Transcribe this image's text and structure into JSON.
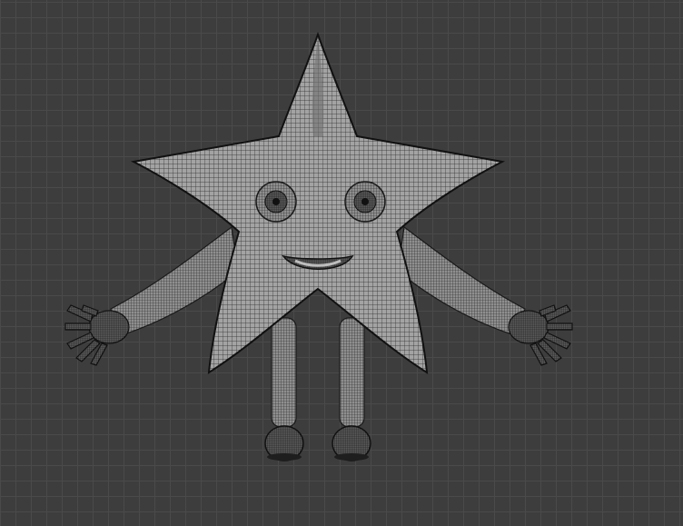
{
  "viewport": {
    "background_color": "#3d3d3d",
    "grid_color": "#4a4a4a",
    "mesh_fill": "#9a9a9a",
    "wire_color": "#262626",
    "shade_color": "#1a1a1a"
  },
  "model": {
    "type": "wireframe-mesh",
    "subject": "star-character"
  }
}
